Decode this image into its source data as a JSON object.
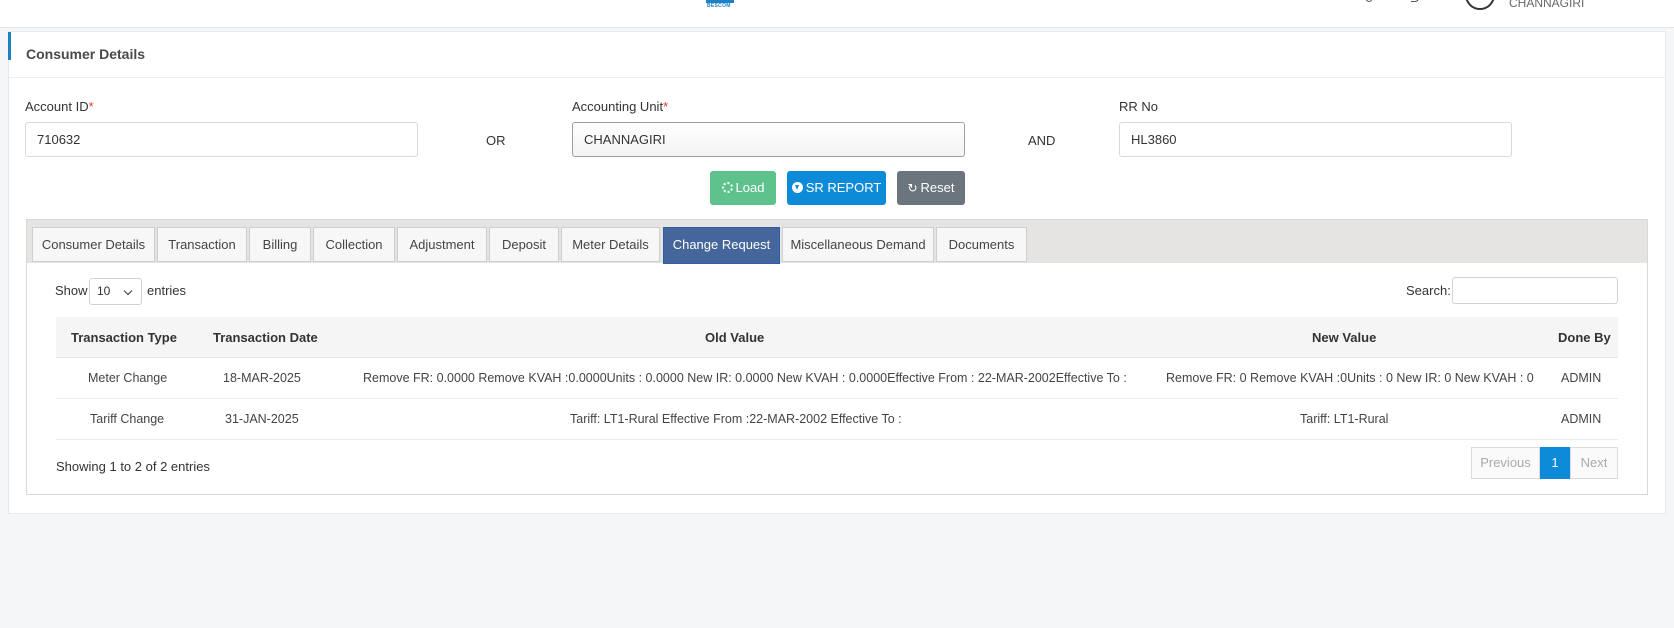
{
  "header": {
    "logo_text": "BESCOM",
    "user_name": "CHANNAGIRI"
  },
  "card": {
    "title": "Consumer Details"
  },
  "form": {
    "account_id_label": "Account ID",
    "account_id_value": "710632",
    "or_label": "OR",
    "accounting_unit_label": "Accounting Unit",
    "accounting_unit_value": "CHANNAGIRI",
    "and_label": "AND",
    "rr_no_label": "RR No",
    "rr_no_value": "HL3860",
    "required_mark": "*"
  },
  "buttons": {
    "load": "Load",
    "sr_report": "SR REPORT",
    "reset": "Reset"
  },
  "tabs": [
    {
      "label": "Consumer Details"
    },
    {
      "label": "Transaction"
    },
    {
      "label": "Billing"
    },
    {
      "label": "Collection"
    },
    {
      "label": "Adjustment"
    },
    {
      "label": "Deposit"
    },
    {
      "label": "Meter Details"
    },
    {
      "label": "Change Request",
      "active": true
    },
    {
      "label": "Miscellaneous Demand"
    },
    {
      "label": "Documents"
    }
  ],
  "table_controls": {
    "show_label": "Show",
    "page_size": "10",
    "entries_label": "entries",
    "search_label": "Search:"
  },
  "table": {
    "columns": [
      "Transaction Type",
      "Transaction Date",
      "Old Value",
      "New Value",
      "Done By"
    ],
    "rows": [
      {
        "type": "Meter Change",
        "date": "18-MAR-2025",
        "old_value": "Remove FR: 0.0000 Remove KVAH :0.0000Units : 0.0000 New IR: 0.0000 New KVAH : 0.0000Effective From : 22-MAR-2002Effective To :",
        "new_value": "Remove FR: 0 Remove KVAH :0Units : 0 New IR: 0 New KVAH : 0",
        "done_by": "ADMIN"
      },
      {
        "type": "Tariff Change",
        "date": "31-JAN-2025",
        "old_value": "Tariff: LT1-Rural Effective From :22-MAR-2002 Effective To :",
        "new_value": "Tariff: LT1-Rural",
        "done_by": "ADMIN"
      }
    ]
  },
  "pagination": {
    "info": "Showing 1 to 2 of 2 entries",
    "previous": "Previous",
    "current": "1",
    "next": "Next"
  },
  "colors": {
    "accent": "#1d7fc4",
    "load": "#5dc28b",
    "sr_report": "#0d8bd8",
    "reset": "#6c757d",
    "active_tab": "#45669a"
  }
}
